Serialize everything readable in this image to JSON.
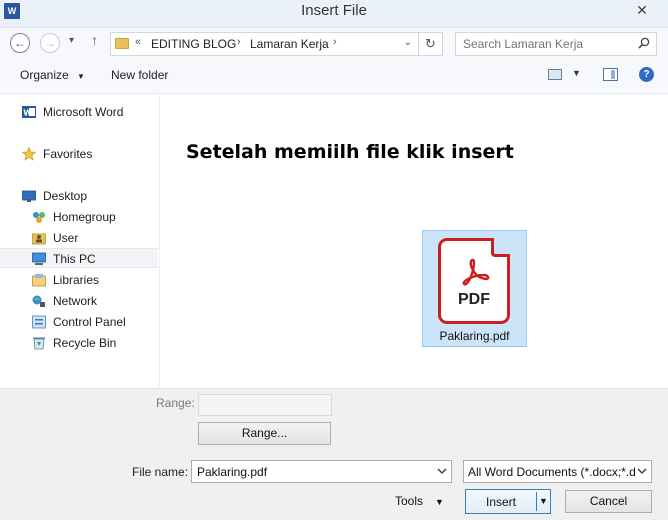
{
  "window": {
    "title": "Insert File",
    "app_icon_letter": "W",
    "close_glyph": "✕"
  },
  "nav": {
    "back_glyph": "←",
    "forward_glyph": "→",
    "recent_glyph": "▾",
    "up_glyph": "↑"
  },
  "address": {
    "overflow": "«",
    "crumbs": [
      "EDITING BLOG",
      "Lamaran Kerja"
    ],
    "separator": "›",
    "dropdown_glyph": "⌄",
    "refresh_glyph": "↻"
  },
  "search": {
    "placeholder": "Search Lamaran Kerja"
  },
  "toolbar": {
    "organize": "Organize",
    "organize_caret": "▼",
    "new_folder": "New folder",
    "view_caret": "▼",
    "help": "?"
  },
  "sidebar": {
    "items": [
      {
        "label": "Microsoft Word",
        "icon": "word-icon"
      },
      {
        "label": "Favorites",
        "icon": "star-icon"
      },
      {
        "label": "Desktop",
        "icon": "desktop-icon"
      },
      {
        "label": "Homegroup",
        "icon": "homegroup-icon"
      },
      {
        "label": "User",
        "icon": "user-folder-icon"
      },
      {
        "label": "This PC",
        "icon": "computer-icon",
        "selected": true
      },
      {
        "label": "Libraries",
        "icon": "libraries-icon"
      },
      {
        "label": "Network",
        "icon": "network-icon"
      },
      {
        "label": "Control Panel",
        "icon": "control-panel-icon"
      },
      {
        "label": "Recycle Bin",
        "icon": "recycle-bin-icon"
      }
    ]
  },
  "content": {
    "instruction": "Setelah memiilh file klik insert",
    "file": {
      "name": "Paklaring.pdf",
      "type_label": "PDF",
      "selected": true
    }
  },
  "bottom": {
    "range_label": "Range:",
    "range_value": "",
    "range_button": "Range...",
    "file_name_label": "File name:",
    "file_name_value": "Paklaring.pdf",
    "file_type_value": "All Word Documents (*.docx;*.d",
    "tools": "Tools",
    "tools_caret": "▼",
    "insert": "Insert",
    "insert_caret": "▼",
    "cancel": "Cancel"
  },
  "colors": {
    "accent": "#2b579a",
    "selection": "#cce4f7",
    "pdf_red": "#cc1f1f"
  }
}
